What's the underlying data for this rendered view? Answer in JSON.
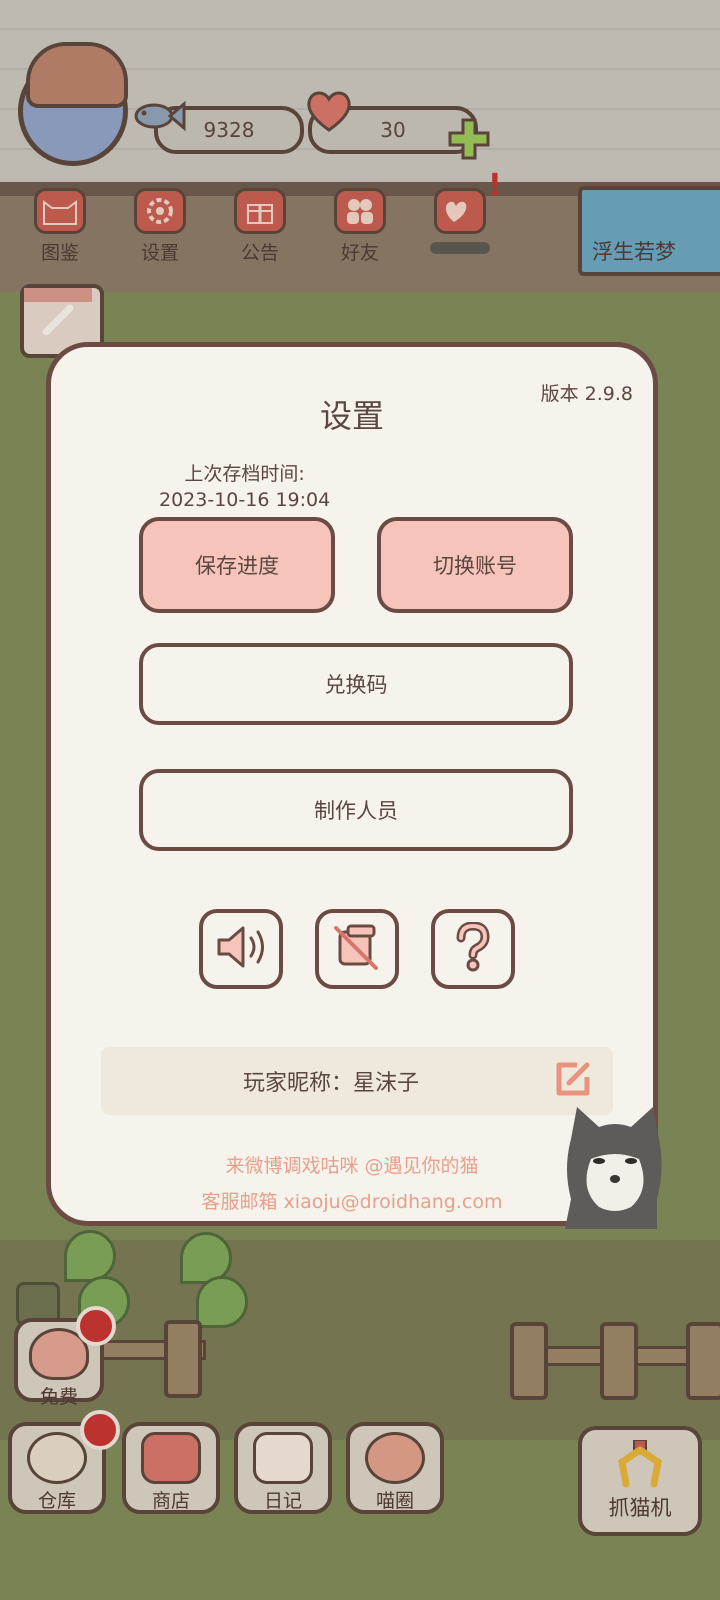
{
  "resources": {
    "fish_count": "9328",
    "heart_count": "30",
    "fish_icon": "fish-icon",
    "heart_icon": "heart-icon",
    "plus_icon": "plus-icon"
  },
  "top_menu": [
    {
      "label": "图鉴",
      "icon": "cat-head-icon"
    },
    {
      "label": "设置",
      "icon": "gear-icon"
    },
    {
      "label": "公告",
      "icon": "gift-icon"
    },
    {
      "label": "好友",
      "icon": "friends-icon"
    },
    {
      "label": "",
      "icon": "hearts-icon"
    }
  ],
  "player_banner": {
    "name": "浮生若梦"
  },
  "settings_modal": {
    "title": "设置",
    "version": "版本 2.9.8",
    "last_save_label": "上次存档时间:",
    "last_save_time": "2023-10-16 19:04",
    "save_button": "保存进度",
    "switch_account_button": "切换账号",
    "redeem_code_button": "兑换码",
    "credits_button": "制作人员",
    "icons": [
      "speaker-icon",
      "music-muted-icon",
      "help-icon"
    ],
    "nickname": "玩家昵称：星沫子",
    "weibo_line": "来微博调戏咕咪 @遇见你的猫",
    "email_line": "客服邮箱 xiaoju@droidhang.com"
  },
  "bottom_bar": {
    "free_label": "免费",
    "warehouse_label": "仓库",
    "shop_label": "商店",
    "diary_label": "日记",
    "circle_label": "喵圈",
    "claw_machine_label": "抓猫机"
  },
  "colors": {
    "modal_bg": "#f6f3ec",
    "modal_border": "#6b4b43",
    "pink_button": "#f6c4ba",
    "footer_text": "#e6a08c",
    "notification": "#c7322f"
  }
}
